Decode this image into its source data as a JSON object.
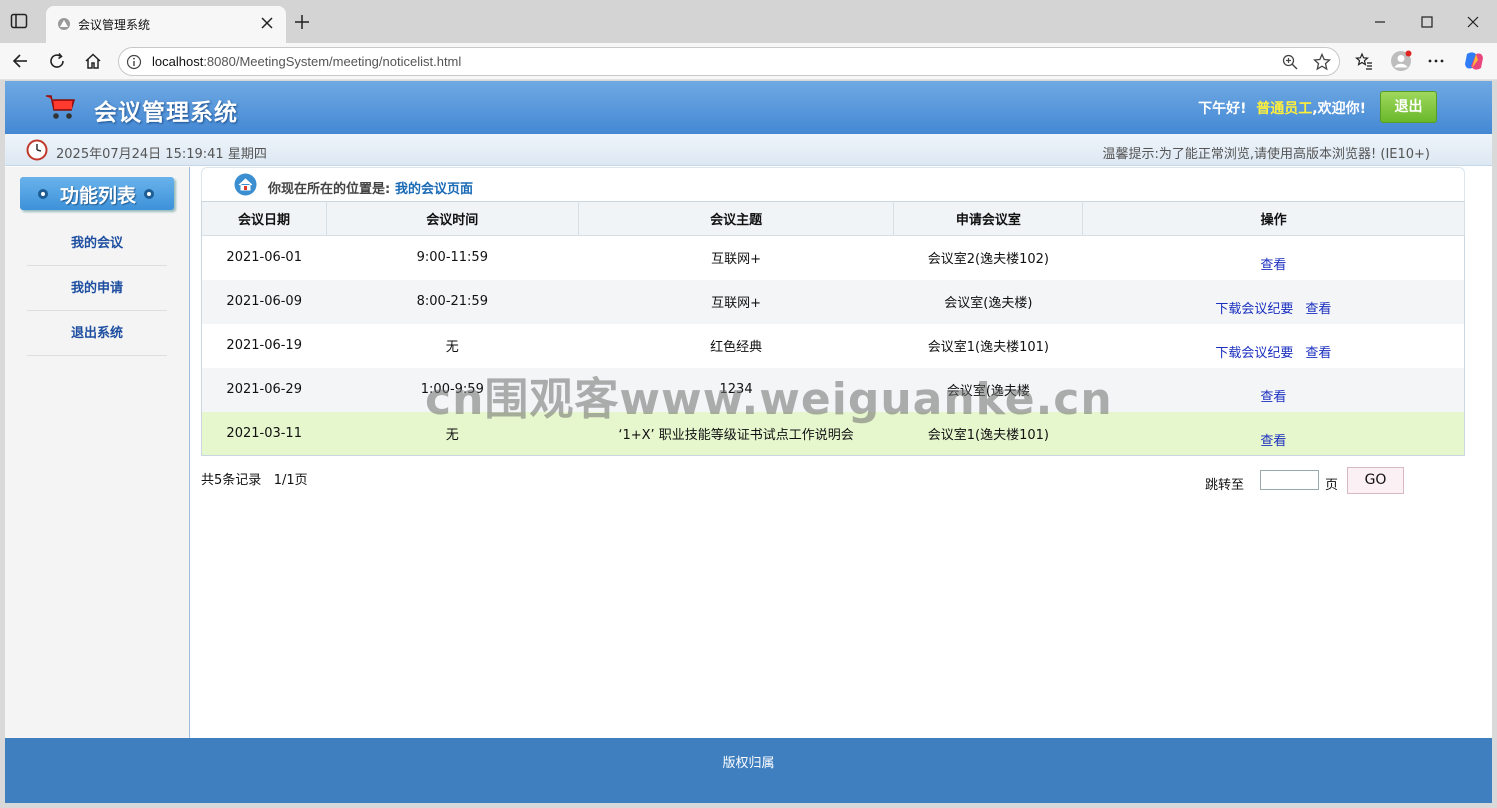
{
  "browser": {
    "tab_title": "会议管理系统",
    "url_host": "localhost",
    "url_rest": ":8080/MeetingSystem/meeting/noticelist.html"
  },
  "header": {
    "app_title": "会议管理系统",
    "greeting": "下午好!",
    "role": "普通员工",
    "welcome": ",欢迎你!",
    "logout_label": "退出"
  },
  "infobar": {
    "datetime": "2025年07月24日 15:19:41 星期四",
    "tip": "温馨提示:为了能正常浏览,请使用高版本浏览器! (IE10+)"
  },
  "sidebar": {
    "title": "功能列表",
    "items": [
      {
        "label": "我的会议"
      },
      {
        "label": "我的申请"
      },
      {
        "label": "退出系统"
      }
    ]
  },
  "location": {
    "label": "你现在所在的位置是:",
    "current": "我的会议页面"
  },
  "table": {
    "headers": [
      "会议日期",
      "会议时间",
      "会议主题",
      "申请会议室",
      "操作"
    ],
    "rows": [
      {
        "date": "2021-06-01",
        "time": "9:00-11:59",
        "topic": "互联网+",
        "room": "会议室2(逸夫楼102)",
        "download": "",
        "view": "查看"
      },
      {
        "date": "2021-06-09",
        "time": "8:00-21:59",
        "topic": "互联网+",
        "room": "会议室(逸夫楼)",
        "download": "下载会议纪要",
        "view": "查看"
      },
      {
        "date": "2021-06-19",
        "time": "无",
        "topic": "红色经典",
        "room": "会议室1(逸夫楼101)",
        "download": "下载会议纪要",
        "view": "查看"
      },
      {
        "date": "2021-06-29",
        "time": "1:00-9:59",
        "topic": "1234",
        "room": "会议室(逸夫楼",
        "download": "",
        "view": "查看"
      },
      {
        "date": "2021-03-11",
        "time": "无",
        "topic": "‘1+X’ 职业技能等级证书试点工作说明会",
        "room": "会议室1(逸夫楼101)",
        "download": "",
        "view": "查看"
      }
    ]
  },
  "pager": {
    "total": "共5条记录",
    "pages": "1/1页",
    "jump_label": "跳转至",
    "unit": "页",
    "go_label": "GO"
  },
  "watermark": "cn围观客www.weiguanke.cn",
  "footer": {
    "text": "版权归属"
  }
}
